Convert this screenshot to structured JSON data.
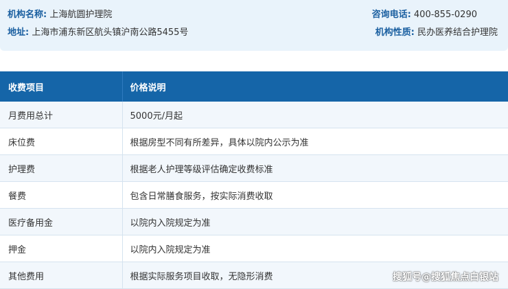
{
  "info": {
    "name_label": "机构名称:",
    "name_value": "上海航圆护理院",
    "address_label": "地址:",
    "address_value": "上海市浦东新区航头镇沪南公路5455号",
    "phone_label": "咨询电话:",
    "phone_value": "400-855-0290",
    "nature_label": "机构性质:",
    "nature_value": "民办医养结合护理院"
  },
  "table": {
    "headers": [
      "收费项目",
      "价格说明"
    ],
    "rows": [
      [
        "月费用总计",
        "5000元/月起"
      ],
      [
        "床位费",
        "根据房型不同有所差异，具体以院内公示为准"
      ],
      [
        "护理费",
        "根据老人护理等级评估确定收费标准"
      ],
      [
        "餐费",
        "包含日常膳食服务，按实际消费收取"
      ],
      [
        "医疗备用金",
        "以院内入院规定为准"
      ],
      [
        "押金",
        "以院内入院规定为准"
      ],
      [
        "其他费用",
        "根据实际服务项目收取，无隐形消费"
      ]
    ]
  },
  "watermark": "搜狐号@搜狐焦点白银站",
  "colors": {
    "header_bg": "#1565a8",
    "label_blue": "#1a5fa0",
    "panel_bg": "#e9f3fb",
    "stripe_bg": "#f2f7fc"
  }
}
